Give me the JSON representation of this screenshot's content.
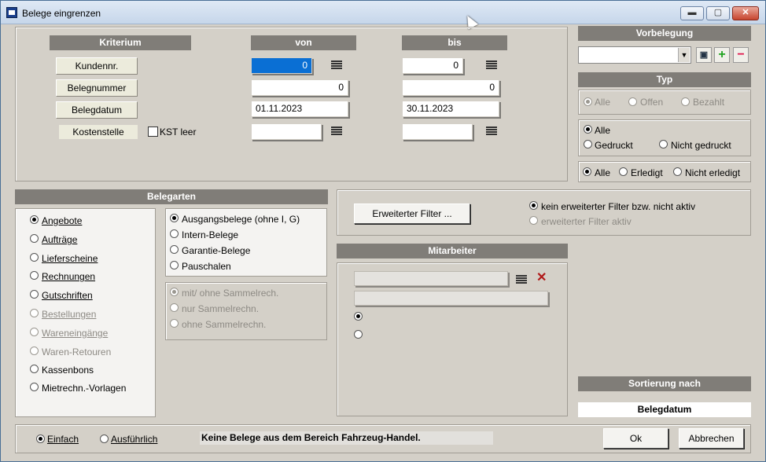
{
  "window": {
    "title": "Belege eingrenzen"
  },
  "titlebar": {
    "minimize": "▬",
    "maximize": "▢",
    "close": "✕"
  },
  "criteria": {
    "header_kriterium": "Kriterium",
    "header_von": "von",
    "header_bis": "bis",
    "rows": [
      {
        "label": "Kundennr.",
        "von": "0",
        "bis": "0"
      },
      {
        "label": "Belegnummer",
        "von": "0",
        "bis": "0"
      },
      {
        "label": "Belegdatum",
        "von": "01.11.2023",
        "bis": "30.11.2023"
      },
      {
        "label": "Kostenstelle",
        "von": "",
        "bis": ""
      }
    ],
    "kst_leer_label": "KST leer"
  },
  "vorbelegung": {
    "header": "Vorbelegung",
    "value": ""
  },
  "typ": {
    "header": "Typ",
    "row1": [
      "Alle",
      "Offen",
      "Bezahlt"
    ],
    "row2": [
      "Alle",
      "Gedruckt",
      "Nicht gedruckt"
    ],
    "row3": [
      "Alle",
      "Erledigt",
      "Nicht erledigt"
    ]
  },
  "belegarten": {
    "header": "Belegarten",
    "items": [
      "Angebote",
      "Aufträge",
      "Lieferscheine",
      "Rechnungen",
      "Gutschriften",
      "Bestellungen",
      "Wareneingänge",
      "Waren-Retouren",
      "Kassenbons",
      "Mietrechn.-Vorlagen"
    ],
    "group1": [
      "Ausgangsbelege (ohne I, G)",
      "Intern-Belege",
      "Garantie-Belege",
      "Pauschalen"
    ],
    "group2": [
      "mit/ ohne Sammelrech.",
      "nur Sammelrechn.",
      "ohne Sammelrechn."
    ]
  },
  "filter": {
    "button": "Erweiterter Filter ...",
    "option1": "kein erweiterter Filter bzw. nicht aktiv",
    "option2": "erweiterter Filter aktiv"
  },
  "mitarbeiter": {
    "header": "Mitarbeiter"
  },
  "sortierung": {
    "header": "Sortierung nach",
    "value": "Belegdatum"
  },
  "footer": {
    "einfach": "Einfach",
    "ausfuehrlich": "Ausführlich",
    "status": "Keine Belege aus dem Bereich Fahrzeug-Handel.",
    "ok": "Ok",
    "abbrechen": "Abbrechen"
  },
  "colors": {
    "header_bg": "#807d78",
    "window_bg": "#d4d0c8",
    "selection": "#0a6fd4",
    "button_bg": "#ecebdc"
  }
}
